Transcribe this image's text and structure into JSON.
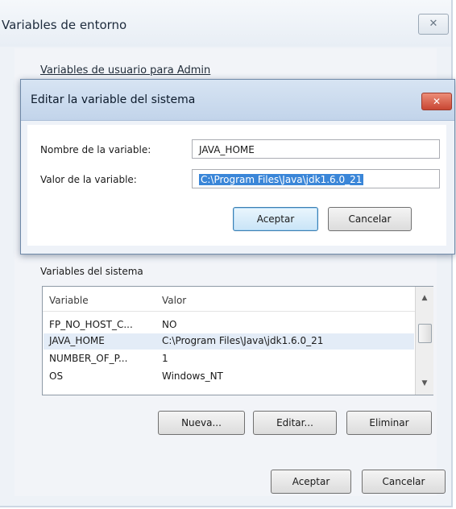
{
  "outer_dialog": {
    "title": "Variables de entorno",
    "close_glyph": "✕",
    "user_vars_label": "Variables de usuario para Admin",
    "system_vars_label": "Variables del sistema",
    "table": {
      "columns": [
        "Variable",
        "Valor"
      ],
      "rows": [
        {
          "variable": "FP_NO_HOST_C...",
          "value": "NO"
        },
        {
          "variable": "JAVA_HOME",
          "value": "C:\\Program Files\\Java\\jdk1.6.0_21"
        },
        {
          "variable": "NUMBER_OF_P...",
          "value": "1"
        },
        {
          "variable": "OS",
          "value": "Windows_NT"
        }
      ],
      "selected_row_index": 1
    },
    "buttons": {
      "new": "Nueva...",
      "edit": "Editar...",
      "delete": "Eliminar",
      "ok": "Aceptar",
      "cancel": "Cancelar"
    }
  },
  "edit_dialog": {
    "title": "Editar la variable del sistema",
    "close_glyph": "✕",
    "name_label": "Nombre de la variable:",
    "name_value": "JAVA_HOME",
    "value_label": "Valor de la variable:",
    "value_value": "C:\\Program Files\\Java\\jdk1.6.0_21",
    "buttons": {
      "ok": "Aceptar",
      "cancel": "Cancelar"
    }
  },
  "icons": {
    "outer_close": "close-icon",
    "inner_close": "close-icon",
    "scroll_up": "chevron-up-icon",
    "scroll_down": "chevron-down-icon"
  },
  "colors": {
    "selection": "#3a86d8",
    "inner_close": "#c84633",
    "titlebar": "#c2d4ea"
  }
}
